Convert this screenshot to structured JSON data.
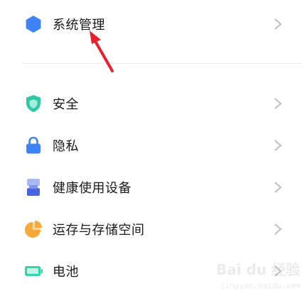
{
  "items": [
    {
      "label": "系统管理",
      "icon": "hexagon-icon"
    },
    {
      "label": "安全",
      "icon": "shield-icon"
    },
    {
      "label": "隐私",
      "icon": "lock-icon"
    },
    {
      "label": "健康使用设备",
      "icon": "hourglass-icon"
    },
    {
      "label": "运存与存储空间",
      "icon": "pie-chart-icon"
    },
    {
      "label": "电池",
      "icon": "battery-icon"
    }
  ],
  "colors": {
    "blue": "#3d82f6",
    "teal": "#2fc7a4",
    "orange": "#f7a83a",
    "battery": "#35d3a8",
    "arrow": "#e8202b",
    "chevron": "#bdbdbd",
    "text": "#1a1a1a"
  },
  "watermark": {
    "brand": "Bai du 经验",
    "url": "jingyan.baidu.com"
  }
}
